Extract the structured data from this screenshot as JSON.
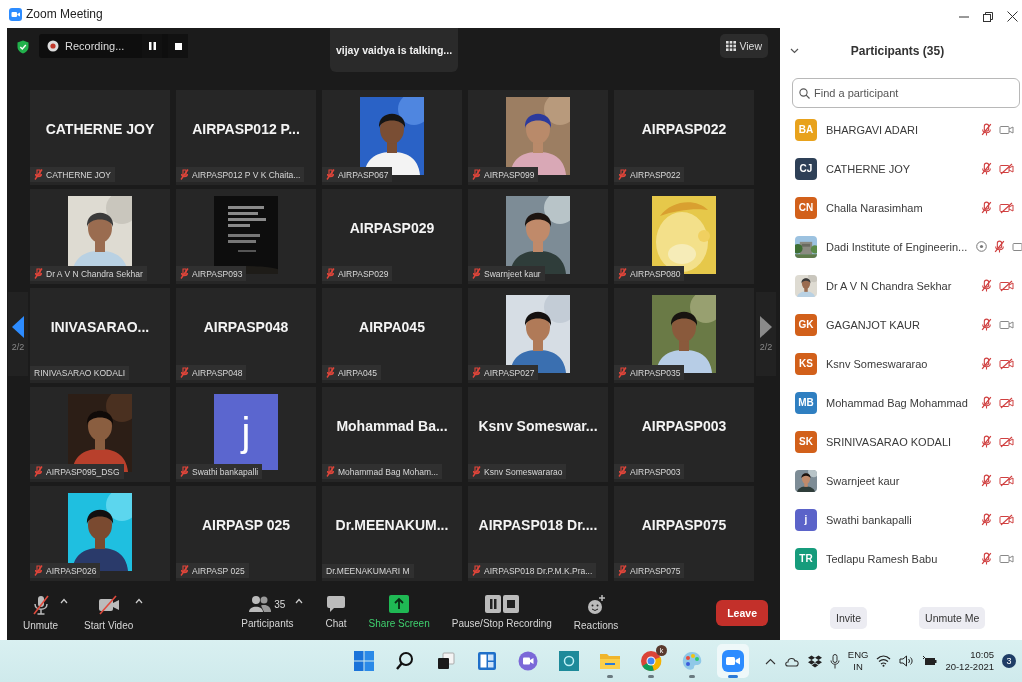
{
  "window": {
    "title": "Zoom Meeting"
  },
  "meeting": {
    "recording": {
      "label": "Recording..."
    },
    "talking": "vijay vaidya is talking...",
    "view_button": "View",
    "tiles": [
      {
        "kind": "name",
        "display": "CATHERNE JOY",
        "label": "CATHERNE JOY",
        "muted": true
      },
      {
        "kind": "name",
        "display": "AIRPASP012 P...",
        "label": "AIRPASP012 P V K Chaita...",
        "muted": true
      },
      {
        "kind": "picture",
        "label": "AIRPASP067",
        "muted": true
      },
      {
        "kind": "picture",
        "label": "AIRPASP099",
        "muted": true
      },
      {
        "kind": "name",
        "display": "AIRPASP022",
        "label": "AIRPASP022",
        "muted": true
      },
      {
        "kind": "picture",
        "label": "Dr A V N Chandra Sekhar",
        "muted": true
      },
      {
        "kind": "picture",
        "label": "AIRPASP093",
        "muted": true
      },
      {
        "kind": "name",
        "display": "AIRPASP029",
        "label": "AIRPASP029",
        "muted": true
      },
      {
        "kind": "picture",
        "label": "Swarnjeet kaur",
        "muted": true
      },
      {
        "kind": "picture",
        "label": "AIRPASP080",
        "muted": true
      },
      {
        "kind": "name",
        "display": "INIVASARAO...",
        "label": "RINIVASARAO KODALI",
        "muted": false
      },
      {
        "kind": "name",
        "display": "AIRPASP048",
        "label": "AIRPASP048",
        "muted": true
      },
      {
        "kind": "name",
        "display": "AIRPA045",
        "label": "AIRPA045",
        "muted": true
      },
      {
        "kind": "picture",
        "label": "AIRPASP027",
        "muted": true
      },
      {
        "kind": "picture",
        "label": "AIRPASP035",
        "muted": true
      },
      {
        "kind": "picture",
        "label": "AIRPASP095_DSG",
        "muted": true
      },
      {
        "kind": "avatar",
        "letter": "j",
        "label": "Swathi bankapalli",
        "muted": true
      },
      {
        "kind": "name",
        "display": "Mohammad Ba...",
        "label": "Mohammad Bag Moham...",
        "muted": true
      },
      {
        "kind": "name",
        "display": "Ksnv Someswar...",
        "label": "Ksnv Someswararao",
        "muted": true
      },
      {
        "kind": "name",
        "display": "AIRPASP003",
        "label": "AIRPASP003",
        "muted": true
      },
      {
        "kind": "picture",
        "label": "AIRPASP026",
        "muted": true
      },
      {
        "kind": "name",
        "display": "AIRPASP 025",
        "label": "AIRPASP 025",
        "muted": true
      },
      {
        "kind": "name",
        "display": "Dr.MEENAKUM...",
        "label": "Dr.MEENAKUMARI M",
        "muted": false
      },
      {
        "kind": "name",
        "display": "AIRPASP018 Dr....",
        "label": "AIRPASP018 Dr.P.M.K.Pra...",
        "muted": true
      },
      {
        "kind": "name",
        "display": "AIRPASP075",
        "label": "AIRPASP075",
        "muted": true
      }
    ],
    "pager": [
      {
        "label": "2/2",
        "disabled": false
      },
      {
        "label": "2/2",
        "disabled": true
      }
    ],
    "toolbar": {
      "left": [
        {
          "kind": "audio",
          "label": "Unmute",
          "off": true
        },
        {
          "kind": "video",
          "label": "Start Video",
          "off": true
        }
      ],
      "center": [
        {
          "kind": "participants",
          "label": "Participants",
          "count": "35"
        },
        {
          "kind": "chat",
          "label": "Chat"
        },
        {
          "kind": "share",
          "label": "Share Screen"
        },
        {
          "kind": "record",
          "label": "Pause/Stop Recording"
        },
        {
          "kind": "reactions",
          "label": "Reactions"
        }
      ],
      "leave": "Leave"
    }
  },
  "participants": {
    "title": "Participants (35)",
    "search": {
      "placeholder": "Find a participant"
    },
    "items": [
      {
        "kind": "initials",
        "initials": "BA",
        "color": "#e8a21c",
        "name": "BHARGAVI ADARI",
        "recording": false,
        "muted": true,
        "video_off": false
      },
      {
        "kind": "initials",
        "initials": "CJ",
        "color": "#2e4057",
        "name": "CATHERNE JOY",
        "recording": false,
        "muted": true,
        "video_off": true
      },
      {
        "kind": "initials",
        "initials": "CN",
        "color": "#d2601a",
        "name": "Challa Narasimham",
        "recording": false,
        "muted": true,
        "video_off": true
      },
      {
        "kind": "picture",
        "name": "Dadi Institute of Engineerin...",
        "recording": true,
        "muted": true,
        "video_off": false
      },
      {
        "kind": "picture",
        "name": "Dr A V N Chandra Sekhar",
        "recording": false,
        "muted": true,
        "video_off": true
      },
      {
        "kind": "initials",
        "initials": "GK",
        "color": "#d2601a",
        "name": "GAGANJOT KAUR",
        "recording": false,
        "muted": true,
        "video_off": false
      },
      {
        "kind": "initials",
        "initials": "KS",
        "color": "#d2601a",
        "name": "Ksnv Someswararao",
        "recording": false,
        "muted": true,
        "video_off": true
      },
      {
        "kind": "initials",
        "initials": "MB",
        "color": "#2f7fc1",
        "name": "Mohammad Bag Mohammad",
        "recording": false,
        "muted": true,
        "video_off": true
      },
      {
        "kind": "initials",
        "initials": "SK",
        "color": "#d2601a",
        "name": "SRINIVASARAO KODALI",
        "recording": false,
        "muted": true,
        "video_off": true
      },
      {
        "kind": "picture",
        "name": "Swarnjeet kaur",
        "recording": false,
        "muted": true,
        "video_off": true
      },
      {
        "kind": "initials",
        "initials": "j",
        "color": "#5b63c9",
        "name": "Swathi bankapalli",
        "recording": false,
        "muted": true,
        "video_off": true
      },
      {
        "kind": "initials",
        "initials": "TR",
        "color": "#169c7c",
        "name": "Tedlapu Ramesh Babu",
        "recording": false,
        "muted": true,
        "video_off": false
      }
    ],
    "buttons": [
      "Invite",
      "Unmute Me"
    ]
  },
  "taskbar": {
    "apps": [
      {
        "kind": "start",
        "active": false,
        "running": false
      },
      {
        "kind": "search",
        "active": false,
        "running": false
      },
      {
        "kind": "taskview",
        "active": false,
        "running": false
      },
      {
        "kind": "widgets",
        "active": false,
        "running": false
      },
      {
        "kind": "chat",
        "active": false,
        "running": false
      },
      {
        "kind": "ring",
        "active": false,
        "running": false
      },
      {
        "kind": "folder",
        "active": false,
        "running": true
      },
      {
        "kind": "browser",
        "badge": "k",
        "active": false,
        "running": true
      },
      {
        "kind": "palette",
        "active": false,
        "running": true
      },
      {
        "kind": "zoom",
        "active": true,
        "running": true
      }
    ],
    "language": {
      "line1": "ENG",
      "line2": "IN"
    },
    "clock": {
      "time": "10:05",
      "date": "20-12-2021"
    },
    "notifications": "3"
  }
}
